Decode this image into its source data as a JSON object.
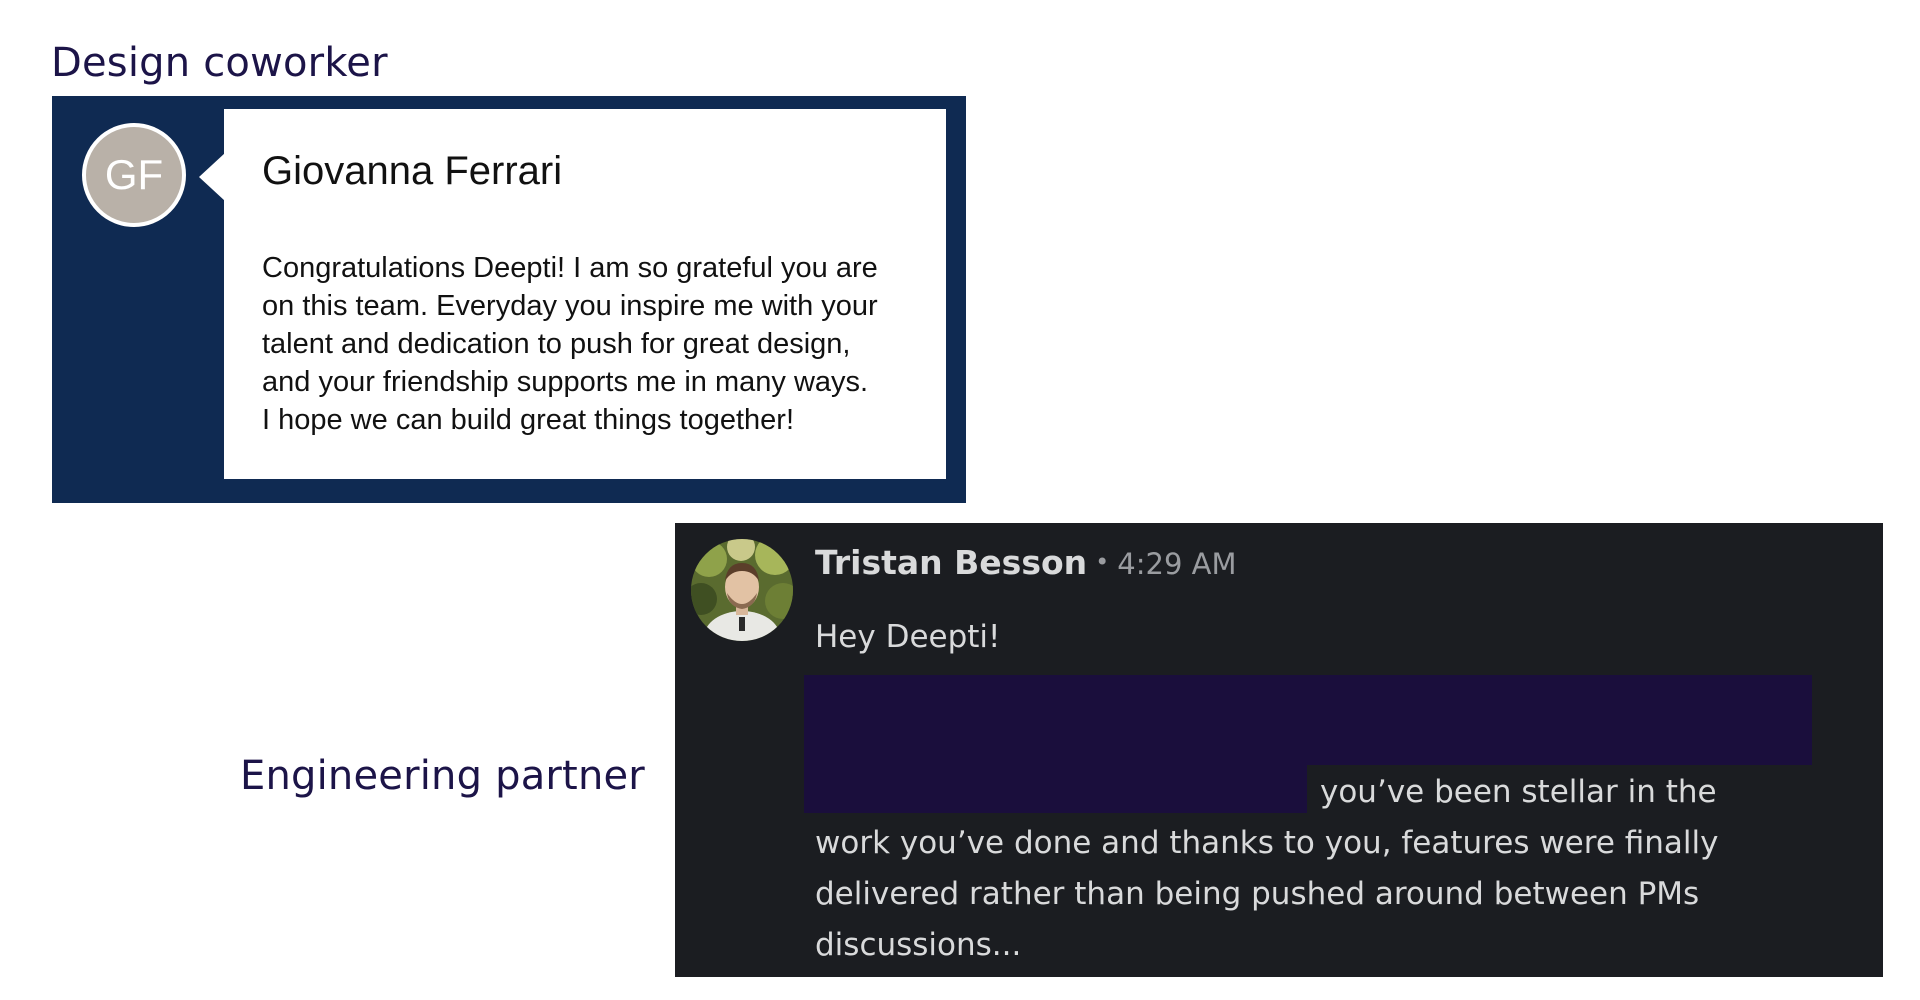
{
  "sections": {
    "design": {
      "heading": "Design coworker",
      "author_initials": "GF",
      "author_name": "Giovanna Ferrari",
      "message_lines": [
        "Congratulations Deepti! I am so grateful you are",
        "on this team. Everyday you inspire me with your",
        "talent and dedication to push for great design,",
        "and your friendship supports me in many ways.",
        "I hope we can build great things together!"
      ],
      "avatar_color": "#b9b1a8",
      "card_color": "#0f2a52"
    },
    "engineering": {
      "heading": "Engineering partner",
      "author_name": "Tristan Besson",
      "separator": "•",
      "timestamp": "4:29 AM",
      "greeting": "Hey Deepti!",
      "message_lines": [
        "you’ve been stellar in the",
        "work you’ve done and thanks to you, features were finally",
        "delivered rather than being pushed around between PMs",
        "discussions..."
      ],
      "card_color": "#1b1d21",
      "redaction_color": "#1a0e3c"
    }
  },
  "colors": {
    "heading_text": "#1c1448"
  }
}
